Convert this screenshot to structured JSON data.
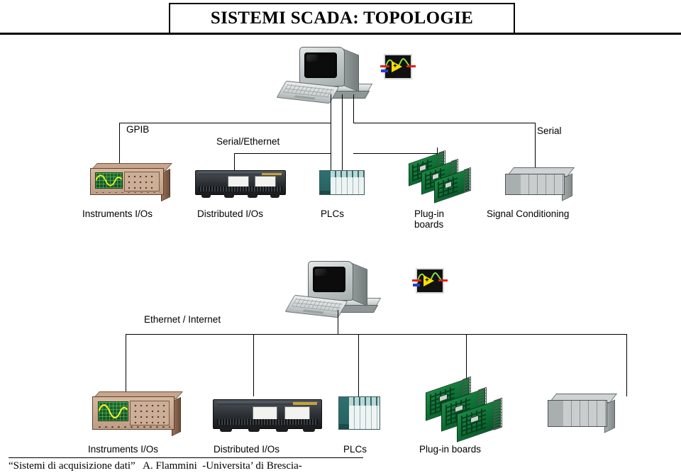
{
  "slide": {
    "title": "SISTEMI SCADA: TOPOLOGIE",
    "footer": "“Sistemi di acquisizione dati”   A. Flammini  -Universita’ di Brescia-"
  },
  "diagram_top": {
    "bus_labels": [
      {
        "text": "GPIB"
      },
      {
        "text": "Serial/Ethernet"
      },
      {
        "text": "Serial"
      }
    ],
    "host": {
      "name": "desktop-computer",
      "software_icon": "labview-icon"
    },
    "devices": [
      {
        "icon": "instrument-icon",
        "label": "Instruments I/Os"
      },
      {
        "icon": "distributed-io-icon",
        "label": "Distributed I/Os"
      },
      {
        "icon": "plc-icon",
        "label": "PLCs"
      },
      {
        "icon": "plug-in-boards-icon",
        "label": "Plug-in\nboards"
      },
      {
        "icon": "signal-conditioning-icon",
        "label": "Signal Conditioning"
      }
    ]
  },
  "diagram_bottom": {
    "bus_labels": [
      {
        "text": "Ethernet / Internet"
      }
    ],
    "host": {
      "name": "desktop-computer",
      "software_icon": "labview-icon"
    },
    "devices": [
      {
        "icon": "instrument-icon",
        "label": "Instruments I/Os"
      },
      {
        "icon": "distributed-io-icon",
        "label": "Distributed I/Os"
      },
      {
        "icon": "plc-icon",
        "label": "PLCs"
      },
      {
        "icon": "plug-in-boards-icon",
        "label": "Plug-in boards"
      },
      {
        "icon": "signal-conditioning-icon",
        "label": ""
      }
    ]
  },
  "colors": {
    "background": "#ffffff",
    "line": "#000000",
    "board_green": "#0d6b33",
    "plc_teal": "#2f7070",
    "instrument_tan": "#c09d84",
    "screen_green": "#1d6b2a",
    "box_grey": "#b9bdbd"
  }
}
